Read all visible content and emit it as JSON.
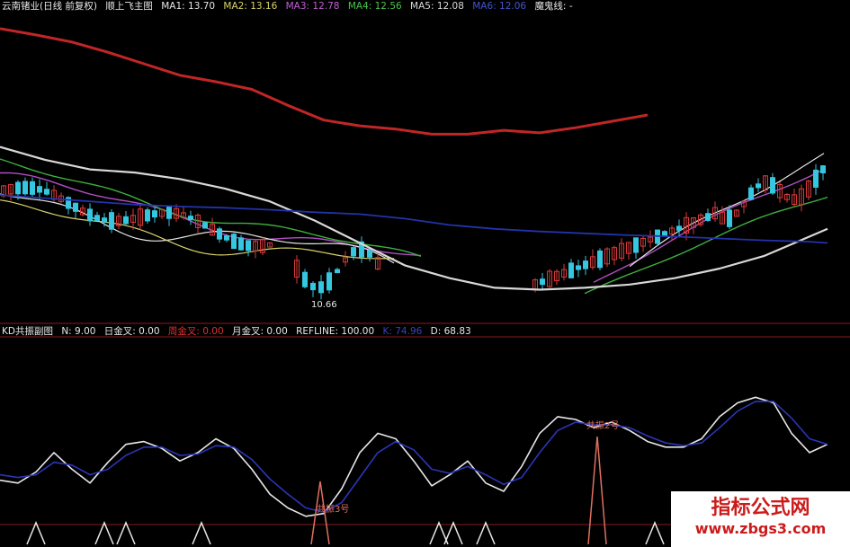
{
  "colors": {
    "background": "#000000",
    "separator": "#8b1a1a",
    "ma1": "#e6e6e6",
    "ma2": "#d9d36a",
    "ma3": "#b04fc4",
    "ma4": "#3fae3f",
    "ma5": "#d8d8d8",
    "ma6": "#2233aa",
    "ghost": "#c12626",
    "k_line": "#e8e8e8",
    "d_line": "#2b35b8",
    "candle_up": "#d83a3a",
    "candle_down": "#35c6e0",
    "signal": "#e8e8e8",
    "signal_red": "#e07060"
  },
  "top_legend": {
    "title": "云南锗业(日线 前复权)",
    "indicator": "顺上飞主图",
    "ma1": "MA1: 13.70",
    "ma2": "MA2: 13.16",
    "ma3": "MA3: 12.78",
    "ma4": "MA4: 12.56",
    "ma5": "MA5: 12.08",
    "ma6": "MA6: 12.06",
    "ghost": "魔鬼线: -"
  },
  "sub_legend": {
    "title": "KD共振副图",
    "n": "N: 9.00",
    "day_cross": "日金叉: 0.00",
    "week_cross": "周金叉: 0.00",
    "month_cross": "月金叉: 0.00",
    "refline": "REFLINE: 100.00",
    "k": "K: 74.96",
    "d": "D: 68.83"
  },
  "annotations": {
    "low_price": "10.66",
    "signal_week": "共振2号",
    "signal_left": "共振3号"
  },
  "watermark": {
    "title": "指标公式网",
    "url": "www.zbgs3.com"
  },
  "chart_data": [
    {
      "type": "line",
      "panel": "main",
      "x": [
        0,
        40,
        80,
        120,
        160,
        200,
        240,
        280,
        320,
        360,
        400,
        440,
        480,
        520,
        560,
        600,
        640,
        680,
        720
      ],
      "series": [
        {
          "name": "魔鬼线",
          "values": [
            14.95,
            14.85,
            14.74,
            14.58,
            14.4,
            14.22,
            14.12,
            14.0,
            13.75,
            13.52,
            13.43,
            13.38,
            13.3,
            13.3,
            13.36,
            13.32,
            13.4,
            13.5,
            13.6
          ]
        }
      ],
      "ylim": [
        10.4,
        15.2
      ]
    },
    {
      "type": "line",
      "panel": "main",
      "x": [
        0,
        50,
        100,
        150,
        200,
        250,
        300,
        350,
        400,
        450,
        500,
        550,
        600,
        650,
        700,
        750,
        800,
        850,
        900,
        920
      ],
      "series": [
        {
          "name": "MA5",
          "values": [
            13.1,
            12.9,
            12.75,
            12.7,
            12.6,
            12.45,
            12.25,
            11.95,
            11.6,
            11.25,
            11.05,
            10.9,
            10.87,
            10.9,
            10.95,
            11.05,
            11.2,
            11.4,
            11.7,
            11.82
          ]
        },
        {
          "name": "MA6",
          "values": [
            12.35,
            12.3,
            12.25,
            12.2,
            12.17,
            12.15,
            12.12,
            12.08,
            12.05,
            11.98,
            11.88,
            11.82,
            11.78,
            11.75,
            11.72,
            11.7,
            11.67,
            11.64,
            11.62,
            11.6
          ]
        }
      ],
      "ylim": [
        10.4,
        15.2
      ]
    },
    {
      "type": "line",
      "panel": "kd",
      "x": [
        0,
        20,
        40,
        60,
        80,
        100,
        120,
        140,
        160,
        180,
        200,
        220,
        240,
        260,
        280,
        300,
        320,
        340,
        360,
        380,
        400,
        420,
        440,
        460,
        480,
        500,
        520,
        540,
        560,
        580,
        600,
        620,
        640,
        660,
        680,
        700,
        720,
        740,
        760,
        780,
        800,
        820,
        840,
        860,
        880,
        900,
        920
      ],
      "series": [
        {
          "name": "K",
          "values": [
            32,
            30,
            38,
            52,
            40,
            30,
            45,
            58,
            60,
            55,
            46,
            52,
            62,
            55,
            40,
            22,
            12,
            6,
            8,
            26,
            52,
            66,
            62,
            46,
            28,
            36,
            46,
            30,
            24,
            42,
            66,
            78,
            76,
            70,
            74,
            68,
            60,
            56,
            56,
            62,
            78,
            88,
            92,
            88,
            66,
            52,
            58
          ]
        },
        {
          "name": "D",
          "values": [
            36,
            34,
            36,
            45,
            43,
            36,
            40,
            50,
            56,
            56,
            50,
            51,
            57,
            56,
            47,
            33,
            22,
            12,
            9,
            16,
            34,
            52,
            60,
            54,
            40,
            37,
            42,
            36,
            29,
            34,
            52,
            68,
            74,
            72,
            72,
            70,
            64,
            59,
            57,
            59,
            70,
            82,
            89,
            89,
            77,
            62,
            58
          ]
        }
      ],
      "ylim": [
        0,
        100
      ]
    }
  ]
}
